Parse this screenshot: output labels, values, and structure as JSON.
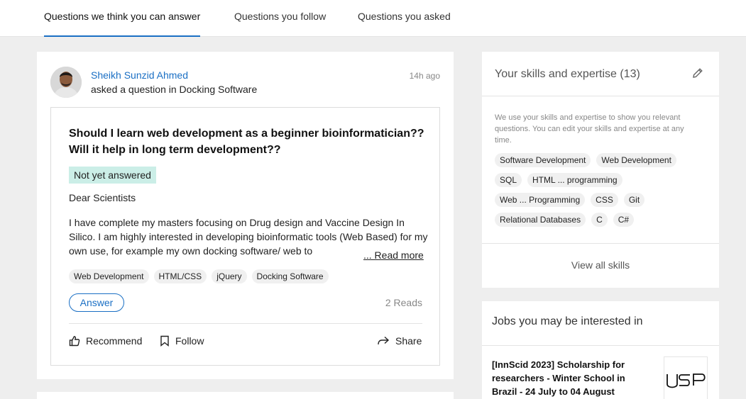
{
  "tabs": [
    {
      "label": "Questions we think you can answer",
      "active": true
    },
    {
      "label": "Questions you follow",
      "active": false
    },
    {
      "label": "Questions you asked",
      "active": false
    }
  ],
  "question": {
    "author": "Sheikh Sunzid Ahmed",
    "asked_prefix": "asked a question in ",
    "topic": "Docking Software",
    "time": "14h ago",
    "title": "Should I learn web development as a beginner bioinformatician?? Will it help in long term development??",
    "status_badge": "Not yet answered",
    "salutation": "Dear Scientists",
    "body": "I have complete my masters focusing on Drug design and Vaccine Design In Silico. I am highly interested in developing bioinformatic tools (Web Based) for my own use, for example my own docking software/ web to",
    "read_more": "... Read more",
    "tags": [
      "Web Development",
      "HTML/CSS",
      "jQuery",
      "Docking Software"
    ],
    "answer_label": "Answer",
    "reads": "2 Reads",
    "actions": {
      "recommend": "Recommend",
      "follow": "Follow",
      "share": "Share"
    }
  },
  "skills": {
    "title": "Your skills and expertise (13)",
    "description": "We use your skills and expertise to show you relevant questions. You can edit your skills and expertise at any time.",
    "rows": [
      [
        "Software Development",
        "Web Development"
      ],
      [
        "SQL",
        "HTML ... programming"
      ],
      [
        "Web ... Programming",
        "CSS",
        "Git"
      ],
      [
        "Relational Databases",
        "C",
        "C#"
      ]
    ],
    "view_all": "View all skills"
  },
  "jobs": {
    "title": "Jobs you may be interested in",
    "job_title": "[InnScid 2023] Scholarship for researchers - Winter School in Brazil - 24 July to 04 August",
    "logo_text": "USP"
  },
  "colors": {
    "accent": "#1a6fc4",
    "badge_bg": "#cbeee7",
    "page_bg": "#eeeeee"
  }
}
